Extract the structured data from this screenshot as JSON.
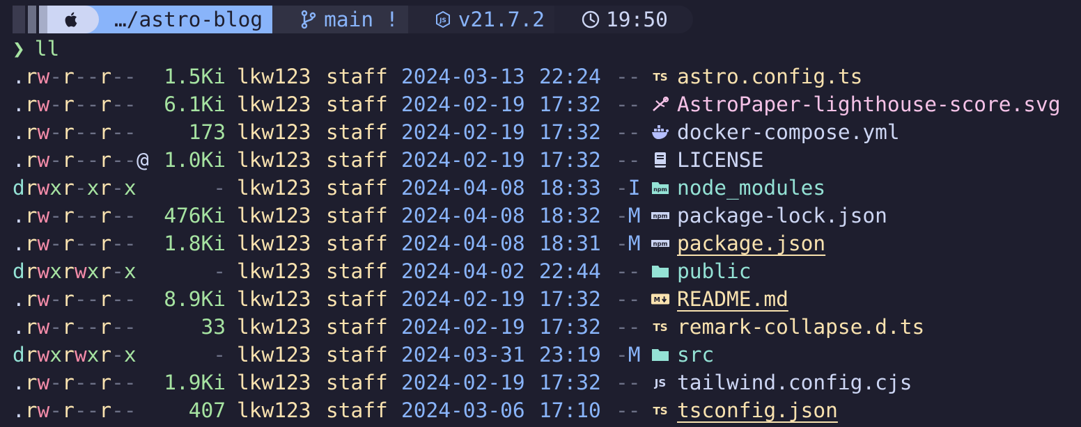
{
  "prompt": {
    "os_icon": "apple-icon",
    "path": "…/astro-blog",
    "git_icon": "git-branch-icon",
    "branch": "main !",
    "node_icon": "nodejs-icon",
    "node_version": "v21.7.2",
    "clock_icon": "clock-icon",
    "time": "19:50"
  },
  "command": {
    "chevron": "❯",
    "text": "ll"
  },
  "colors": {
    "background": "#1e1e2e",
    "text": "#cdd6f4",
    "green": "#a6e3a1",
    "yellow": "#f9e2af",
    "blue": "#89b4fa",
    "teal": "#94e2d5",
    "pink": "#f5c2e7",
    "red": "#f38ba8",
    "dim": "#6c7086"
  },
  "listing": [
    {
      "perm": ".rw-r--r--",
      "at": "",
      "size": "1.5Ki",
      "user": "lkw123",
      "group": "staff",
      "date": "2024-03-13",
      "time": "22:24",
      "git": "--",
      "icon": "typescript-icon",
      "name": "astro.config.ts",
      "color": "#f9e2af",
      "underline": false
    },
    {
      "perm": ".rw-r--r--",
      "at": "",
      "size": "6.1Ki",
      "user": "lkw123",
      "group": "staff",
      "date": "2024-02-19",
      "time": "17:32",
      "git": "--",
      "icon": "svg-icon",
      "name": "AstroPaper-lighthouse-score.svg",
      "color": "#f5c2e7",
      "underline": false
    },
    {
      "perm": ".rw-r--r--",
      "at": "",
      "size": "173",
      "user": "lkw123",
      "group": "staff",
      "date": "2024-02-19",
      "time": "17:32",
      "git": "--",
      "icon": "docker-icon",
      "name": "docker-compose.yml",
      "color": "#cdd6f4",
      "underline": false
    },
    {
      "perm": ".rw-r--r--",
      "at": "@",
      "size": "1.0Ki",
      "user": "lkw123",
      "group": "staff",
      "date": "2024-02-19",
      "time": "17:32",
      "git": "--",
      "icon": "license-book-icon",
      "name": "LICENSE",
      "color": "#cdd6f4",
      "underline": false
    },
    {
      "perm": "drwxr-xr-x",
      "at": "",
      "size": "-",
      "user": "lkw123",
      "group": "staff",
      "date": "2024-04-08",
      "time": "18:33",
      "git": "-I",
      "icon": "npm-folder-icon",
      "name": "node_modules",
      "color": "#94e2d5",
      "underline": false
    },
    {
      "perm": ".rw-r--r--",
      "at": "",
      "size": "476Ki",
      "user": "lkw123",
      "group": "staff",
      "date": "2024-04-08",
      "time": "18:32",
      "git": "-M",
      "icon": "npm-icon",
      "name": "package-lock.json",
      "color": "#cdd6f4",
      "underline": false
    },
    {
      "perm": ".rw-r--r--",
      "at": "",
      "size": "1.8Ki",
      "user": "lkw123",
      "group": "staff",
      "date": "2024-04-08",
      "time": "18:31",
      "git": "-M",
      "icon": "npm-icon",
      "name": "package.json",
      "color": "#f9e2af",
      "underline": true
    },
    {
      "perm": "drwxrwxr-x",
      "at": "",
      "size": "-",
      "user": "lkw123",
      "group": "staff",
      "date": "2024-04-02",
      "time": "22:44",
      "git": "--",
      "icon": "folder-icon",
      "name": "public",
      "color": "#94e2d5",
      "underline": false
    },
    {
      "perm": ".rw-r--r--",
      "at": "",
      "size": "8.9Ki",
      "user": "lkw123",
      "group": "staff",
      "date": "2024-02-19",
      "time": "17:32",
      "git": "--",
      "icon": "markdown-icon",
      "name": "README.md",
      "color": "#f9e2af",
      "underline": true
    },
    {
      "perm": ".rw-r--r--",
      "at": "",
      "size": "33",
      "user": "lkw123",
      "group": "staff",
      "date": "2024-02-19",
      "time": "17:32",
      "git": "--",
      "icon": "typescript-icon",
      "name": "remark-collapse.d.ts",
      "color": "#f9e2af",
      "underline": false
    },
    {
      "perm": "drwxrwxr-x",
      "at": "",
      "size": "-",
      "user": "lkw123",
      "group": "staff",
      "date": "2024-03-31",
      "time": "23:19",
      "git": "-M",
      "icon": "folder-icon",
      "name": "src",
      "color": "#94e2d5",
      "underline": false
    },
    {
      "perm": ".rw-r--r--",
      "at": "",
      "size": "1.9Ki",
      "user": "lkw123",
      "group": "staff",
      "date": "2024-02-19",
      "time": "17:32",
      "git": "--",
      "icon": "javascript-icon",
      "name": "tailwind.config.cjs",
      "color": "#cdd6f4",
      "underline": false
    },
    {
      "perm": ".rw-r--r--",
      "at": "",
      "size": "407",
      "user": "lkw123",
      "group": "staff",
      "date": "2024-03-06",
      "time": "17:10",
      "git": "--",
      "icon": "typescript-icon",
      "name": "tsconfig.json",
      "color": "#f9e2af",
      "underline": true
    }
  ]
}
